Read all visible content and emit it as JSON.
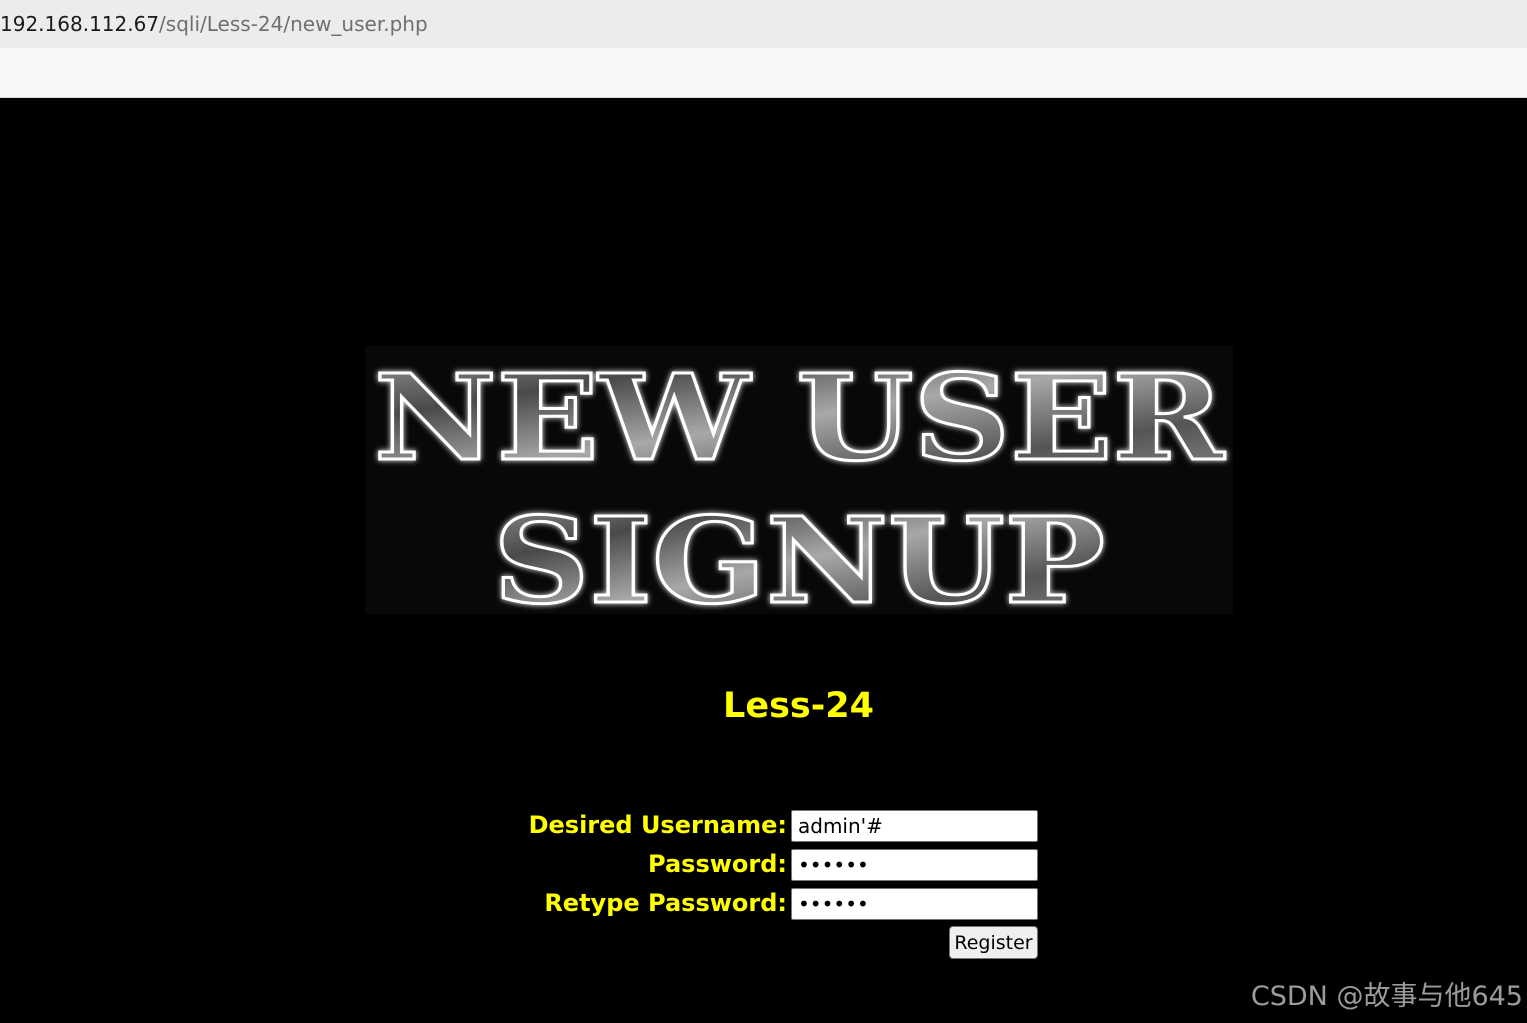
{
  "browser": {
    "url_host": "192.168.112.67",
    "url_path": "/sqli/Less-24/new_user.php"
  },
  "banner": {
    "line1": "NEW USER",
    "line2": "SIGNUP"
  },
  "lesson_title": "Less-24",
  "form": {
    "username_label": "Desired Username:",
    "username_value": "admin'#",
    "password_label": "Password:",
    "password_value": "123456",
    "retype_label": "Retype Password:",
    "retype_value": "123456",
    "register_label": "Register"
  },
  "watermark": "CSDN @故事与他645",
  "colors": {
    "label_yellow": "#ffff00",
    "background": "#000000"
  }
}
